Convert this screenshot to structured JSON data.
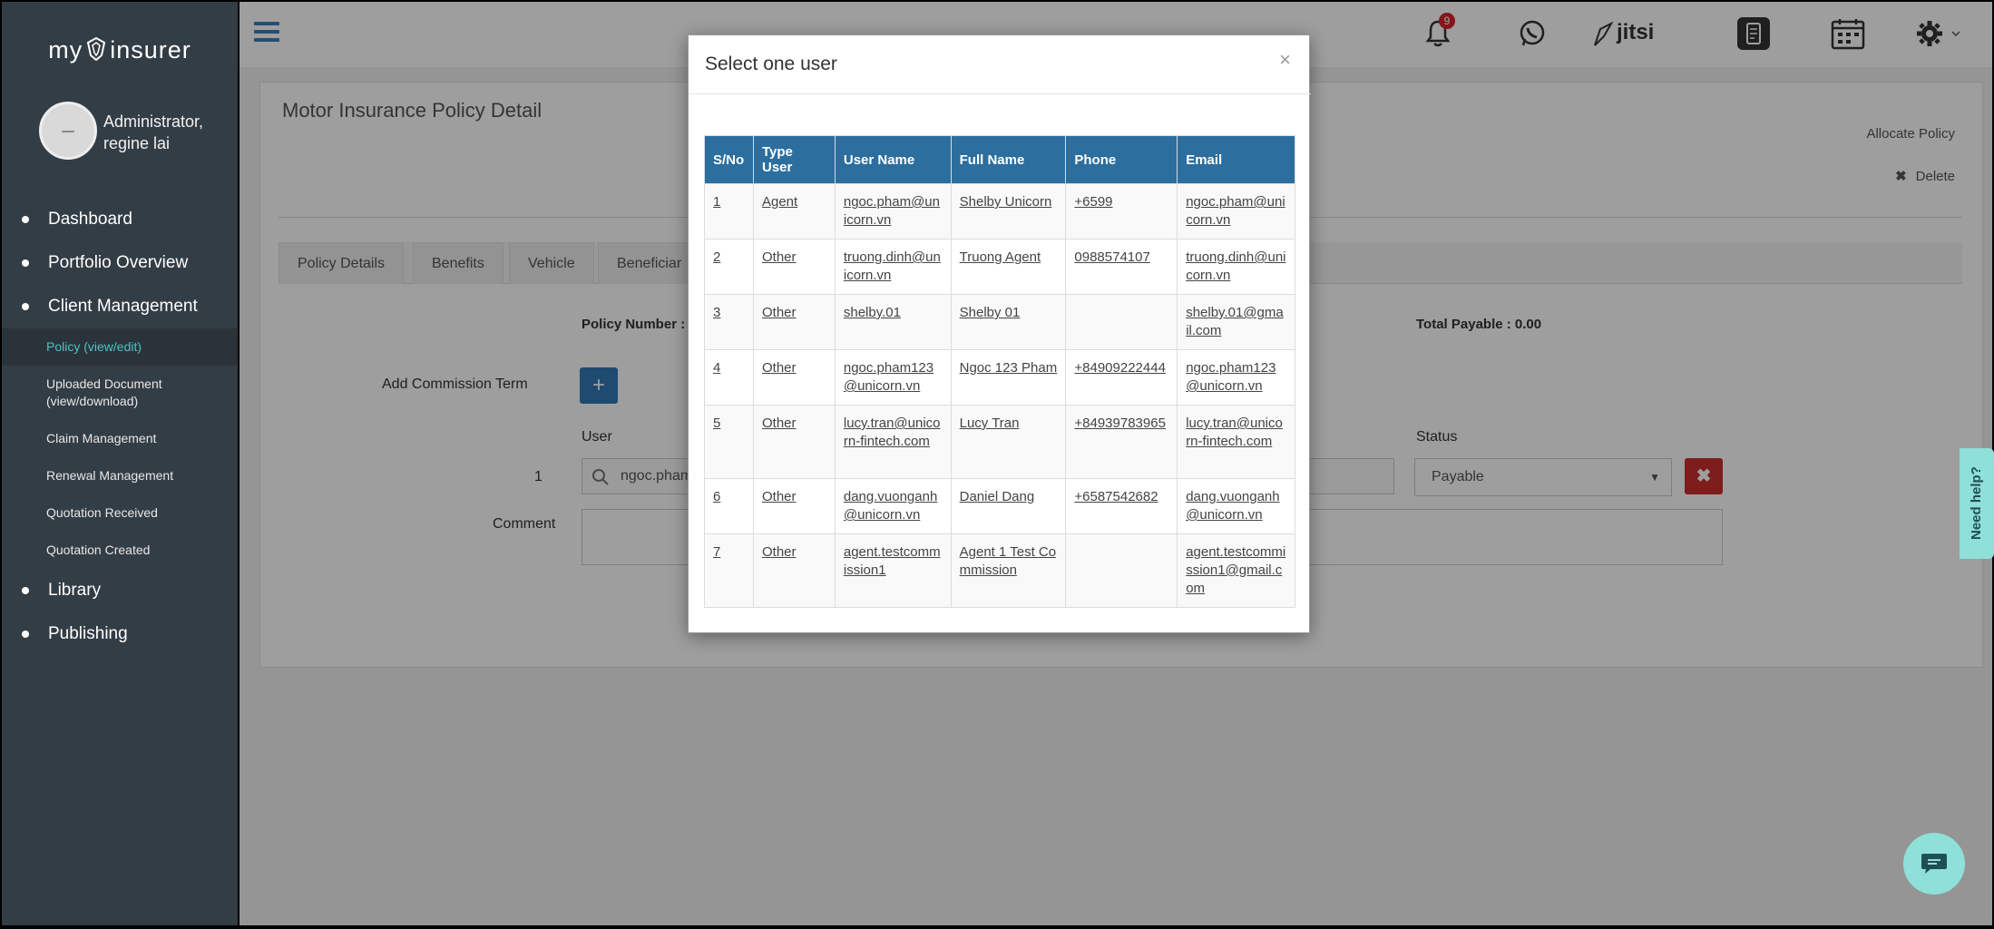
{
  "sidebar": {
    "brand": {
      "left": "my",
      "right": "insurer"
    },
    "user": {
      "line1": "Administrator,",
      "line2": "regine lai"
    },
    "nav": [
      {
        "label": "Dashboard"
      },
      {
        "label": "Portfolio Overview"
      },
      {
        "label": "Client Management"
      }
    ],
    "sub": [
      {
        "label": "Policy (view/edit)",
        "active": true
      },
      {
        "label": "Uploaded Document (view/download)"
      },
      {
        "label": "Claim Management"
      },
      {
        "label": "Renewal Management"
      },
      {
        "label": "Quotation Received"
      },
      {
        "label": "Quotation Created"
      }
    ],
    "nav_bottom": [
      {
        "label": "Library"
      },
      {
        "label": "Publishing"
      }
    ]
  },
  "topbar": {
    "notification_count": "9",
    "jitsi_label": "jitsi"
  },
  "page": {
    "title": "Motor Insurance Policy Detail",
    "allocate": "Allocate Policy",
    "delete": "Delete",
    "tabs": [
      "Policy Details",
      "Benefits",
      "Vehicle",
      "Beneficiar"
    ],
    "policy_number_label": "Policy Number :",
    "total_payable": "Total Payable : 0.00",
    "add_commission_label": "Add Commission Term",
    "user_label": "User",
    "status_label": "Status",
    "row_number": "1",
    "user_value": "ngoc.pham@u",
    "status_value": "Payable",
    "comment_label": "Comment"
  },
  "modal": {
    "title": "Select one user",
    "close": "×",
    "columns": [
      "S/No",
      "Type User",
      "User Name",
      "Full Name",
      "Phone",
      "Email"
    ],
    "rows": [
      {
        "sno": "1",
        "type": "Agent",
        "username": "ngoc.pham@unicorn.vn",
        "fullname": "Shelby Unicorn",
        "phone": "+6599",
        "email": "ngoc.pham@unicorn.vn"
      },
      {
        "sno": "2",
        "type": "Other",
        "username": "truong.dinh@unicorn.vn",
        "fullname": "Truong Agent",
        "phone": "0988574107",
        "email": "truong.dinh@unicorn.vn"
      },
      {
        "sno": "3",
        "type": "Other",
        "username": "shelby.01",
        "fullname": "Shelby 01",
        "phone": "",
        "email": "shelby.01@gmail.com"
      },
      {
        "sno": "4",
        "type": "Other",
        "username": "ngoc.pham123@unicorn.vn",
        "fullname": "Ngoc 123 Pham",
        "phone": "+84909222444",
        "email": "ngoc.pham123@unicorn.vn"
      },
      {
        "sno": "5",
        "type": "Other",
        "username": "lucy.tran@unicorn-fintech.com",
        "fullname": "Lucy Tran",
        "phone": "+84939783965",
        "email": "lucy.tran@unicorn-fintech.com"
      },
      {
        "sno": "6",
        "type": "Other",
        "username": "dang.vuonganh@unicorn.vn",
        "fullname": "Daniel Dang",
        "phone": "+6587542682",
        "email": "dang.vuonganh@unicorn.vn"
      },
      {
        "sno": "7",
        "type": "Other",
        "username": "agent.testcommission1",
        "fullname": "Agent 1 Test Commission",
        "phone": "",
        "email": "agent.testcommission1@gmail.com"
      }
    ]
  },
  "widgets": {
    "help_label": "Need help?"
  },
  "colors": {
    "sidebar": "#333d45",
    "accent": "#337ab7",
    "table_header": "#2c6e9e",
    "active_sub": "#4bc3c9",
    "danger": "#c9302c",
    "help": "#8fe0d8"
  }
}
